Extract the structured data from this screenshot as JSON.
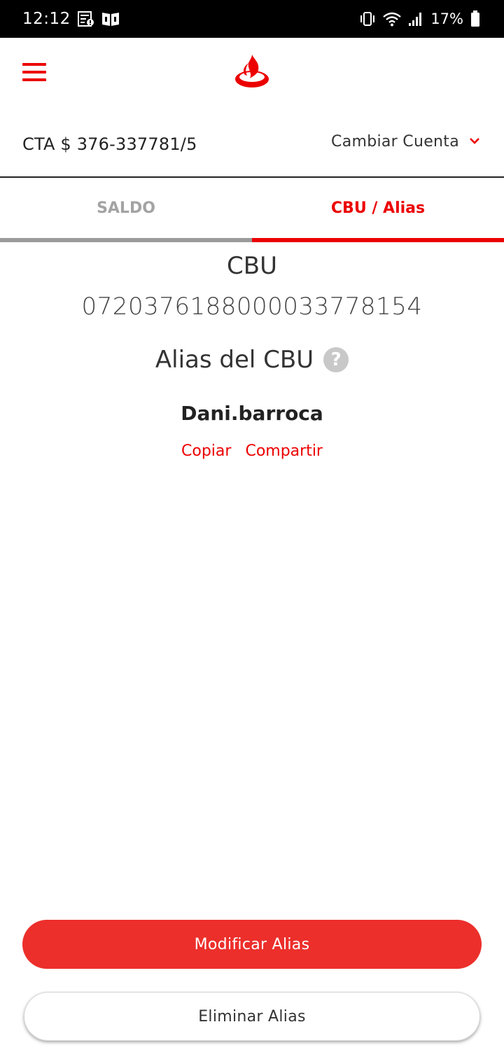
{
  "status_bar": {
    "time": "12:12",
    "battery_percent": "17%",
    "icons": [
      "list-notification-icon",
      "book-notification-icon",
      "vibrate-icon",
      "wifi-icon",
      "signal-icon",
      "battery-icon"
    ]
  },
  "header": {
    "menu_icon": "hamburger-menu-icon",
    "logo_icon": "flame-logo-icon"
  },
  "account": {
    "number": "CTA $ 376-337781/5",
    "change_label": "Cambiar Cuenta"
  },
  "tabs": [
    {
      "label": "SALDO",
      "active": false
    },
    {
      "label": "CBU / Alias",
      "active": true
    }
  ],
  "cbu": {
    "title": "CBU",
    "number": "0720376188000033778154"
  },
  "alias": {
    "title": "Alias del CBU",
    "help_symbol": "?",
    "value": "Dani.barroca",
    "copy_label": "Copiar",
    "share_label": "Compartir"
  },
  "buttons": {
    "modify_label": "Modificar Alias",
    "delete_label": "Eliminar Alias"
  },
  "colors": {
    "brand_red": "#ec0000",
    "button_red": "#ec2f2b",
    "inactive_gray": "#9b9b9b"
  }
}
